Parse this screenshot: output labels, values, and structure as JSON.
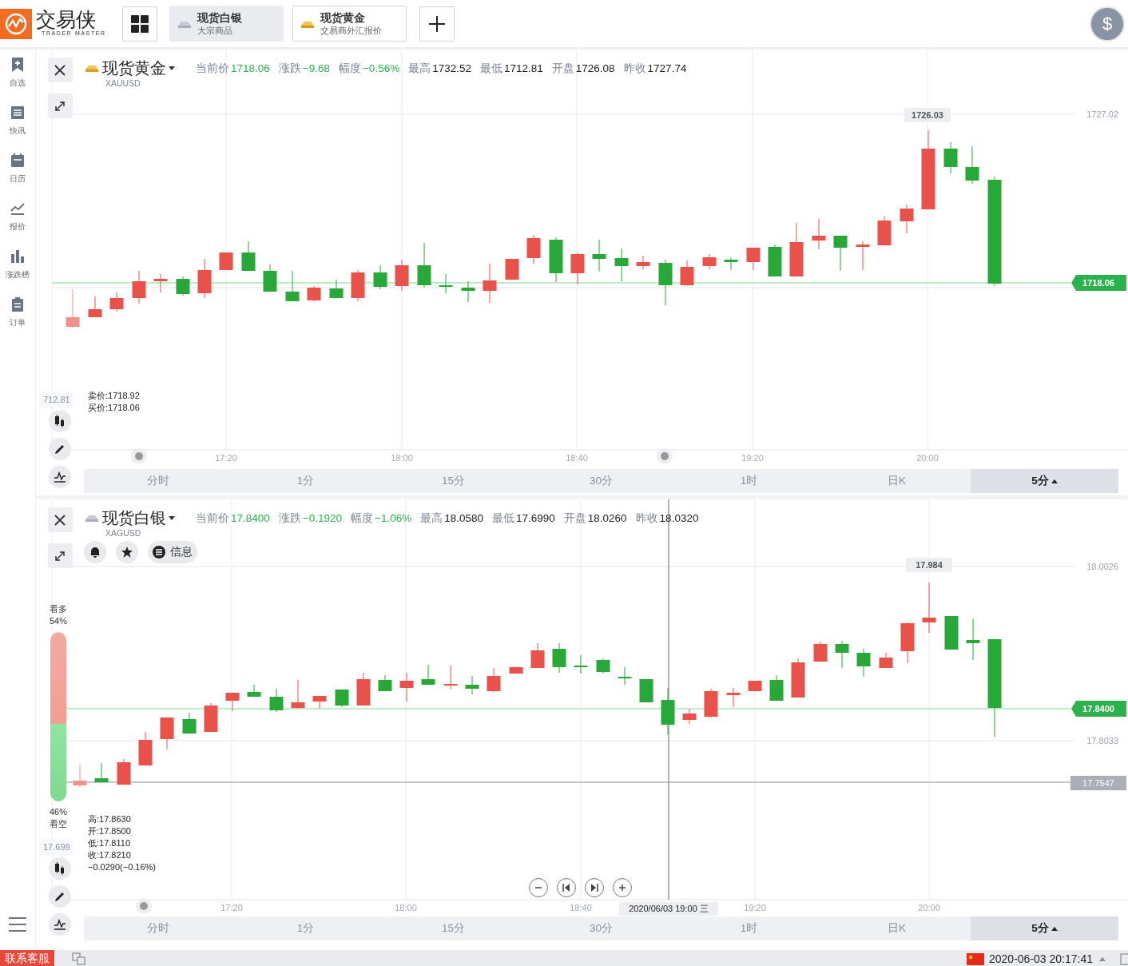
{
  "header": {
    "logo_text": "交易侠",
    "logo_subtitle": "TRADER MASTER",
    "tabs": [
      {
        "title": "现货白银",
        "subtitle": "大宗商品",
        "selected": true
      },
      {
        "title": "现货黄金",
        "subtitle": "交易商外汇报价",
        "selected": false
      }
    ],
    "account_symbol": "$"
  },
  "sidebar": {
    "items": [
      {
        "label": "自选"
      },
      {
        "label": "快讯"
      },
      {
        "label": "日历"
      },
      {
        "label": "报价"
      },
      {
        "label": "涨跌榜"
      },
      {
        "label": "订单"
      }
    ]
  },
  "panels": [
    {
      "title": "现货黄金",
      "symbol": "XAUUSD",
      "stats": [
        {
          "label": "当前价",
          "value": "1718.06",
          "color": "#2bb24c"
        },
        {
          "label": "涨跌",
          "value": "−9.68",
          "color": "#2bb24c"
        },
        {
          "label": "幅度",
          "value": "−0.56%",
          "color": "#2bb24c"
        },
        {
          "label": "最高",
          "value": "1732.52",
          "color": "#222222"
        },
        {
          "label": "最低",
          "value": "1712.81",
          "color": "#222222"
        },
        {
          "label": "开盘",
          "value": "1726.08",
          "color": "#222222"
        },
        {
          "label": "昨收",
          "value": "1727.74",
          "color": "#222222"
        }
      ],
      "y_labels": [
        "1727.02"
      ],
      "price_tag": "1718.06",
      "high_marker": "1726.03",
      "edge_label": "712.81",
      "info_lines": [
        "卖价:1718.92",
        "买价:1718.06"
      ],
      "time_labels": [
        "17:20",
        "18:00",
        "18:40",
        "19:20",
        "20:00"
      ],
      "timeframes": [
        {
          "label": "分时",
          "selected": false
        },
        {
          "label": "1分",
          "selected": false
        },
        {
          "label": "15分",
          "selected": false
        },
        {
          "label": "30分",
          "selected": false
        },
        {
          "label": "1时",
          "selected": false
        },
        {
          "label": "日K",
          "selected": false
        },
        {
          "label": "5分",
          "selected": true
        }
      ]
    },
    {
      "title": "现货白银",
      "symbol": "XAGUSD",
      "stats": [
        {
          "label": "当前价",
          "value": "17.8400",
          "color": "#2bb24c"
        },
        {
          "label": "涨跌",
          "value": "−0.1920",
          "color": "#2bb24c"
        },
        {
          "label": "幅度",
          "value": "−1.06%",
          "color": "#2bb24c"
        },
        {
          "label": "最高",
          "value": "18.0580",
          "color": "#222222"
        },
        {
          "label": "最低",
          "value": "17.6990",
          "color": "#222222"
        },
        {
          "label": "开盘",
          "value": "18.0260",
          "color": "#222222"
        },
        {
          "label": "昨收",
          "value": "18.0320",
          "color": "#222222"
        }
      ],
      "actions": [
        {
          "kind": "bell"
        },
        {
          "kind": "star"
        },
        {
          "kind": "info",
          "label": "信息"
        }
      ],
      "y_labels": [
        "18.0026",
        "17.8033"
      ],
      "price_tag": "17.8400",
      "cursor_tag": "17.7547",
      "high_marker": "17.984",
      "edge_label": "17.699",
      "sentiment": {
        "bull_label": "看多",
        "bull_pct": "54%",
        "bear_pct": "46%",
        "bear_label": "看空",
        "level": 0.54
      },
      "info_lines": [
        "高:17.8630",
        "开:17.8500",
        "低:17.8110",
        "收:17.8210",
        "−0.0290(−0.16%)"
      ],
      "crosshair_label": "2020/06/03 19:00 三",
      "chart_controls": [
        {
          "kind": "zoom_out"
        },
        {
          "kind": "step_back"
        },
        {
          "kind": "step_forward"
        },
        {
          "kind": "zoom_in"
        }
      ],
      "time_labels": [
        "17:20",
        "18:00",
        "18:40",
        "19:20",
        "20:00"
      ],
      "timeframes": [
        {
          "label": "分时",
          "selected": false
        },
        {
          "label": "1分",
          "selected": false
        },
        {
          "label": "15分",
          "selected": false
        },
        {
          "label": "30分",
          "selected": false
        },
        {
          "label": "1时",
          "selected": false
        },
        {
          "label": "日K",
          "selected": false
        },
        {
          "label": "5分",
          "selected": true
        }
      ]
    }
  ],
  "status_bar": {
    "support_label": "联系客服",
    "datetime": "2020-06-03 20:17:41"
  }
}
